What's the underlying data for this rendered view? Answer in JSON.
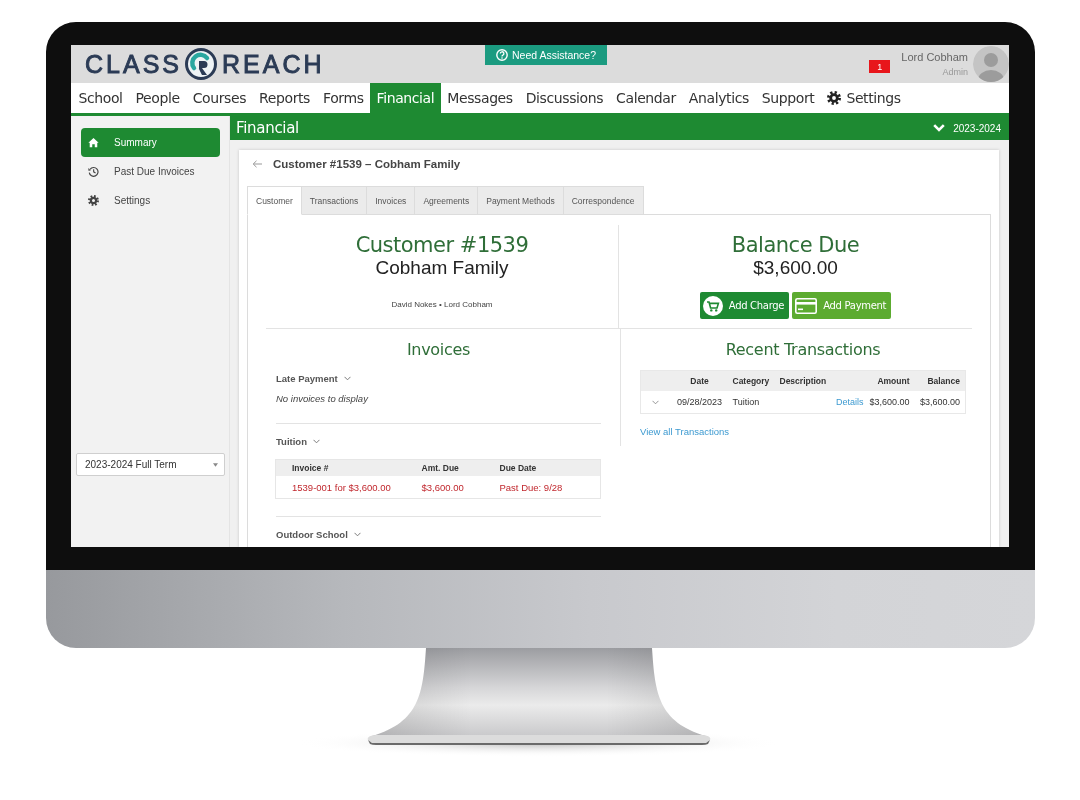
{
  "logo": {
    "left_text": "CLASS",
    "right_text": "REACH"
  },
  "help_button": {
    "label": "Need Assistance?"
  },
  "user": {
    "alert_count": "1",
    "name": "Lord Cobham",
    "role": "Admin"
  },
  "nav": [
    {
      "label": "School",
      "selected": false,
      "kind": "plain"
    },
    {
      "label": "People",
      "selected": false,
      "kind": "plain"
    },
    {
      "label": "Courses",
      "selected": false,
      "kind": "plain"
    },
    {
      "label": "Reports",
      "selected": false,
      "kind": "plain"
    },
    {
      "label": "Forms",
      "selected": false,
      "kind": "plain"
    },
    {
      "label": "Financial",
      "selected": true,
      "kind": "plain"
    },
    {
      "label": "Messages",
      "selected": false,
      "kind": "plain"
    },
    {
      "label": "Discussions",
      "selected": false,
      "kind": "plain"
    },
    {
      "label": "Calendar",
      "selected": false,
      "kind": "plain"
    },
    {
      "label": "Analytics",
      "selected": false,
      "kind": "plain"
    },
    {
      "label": "Support",
      "selected": false,
      "kind": "plain"
    },
    {
      "label": "Settings",
      "selected": false,
      "kind": "settings"
    }
  ],
  "sidebar": {
    "items": [
      {
        "label": "Summary",
        "selected": true,
        "kind": "home"
      },
      {
        "label": "Past Due Invoices",
        "selected": false,
        "kind": "history"
      },
      {
        "label": "Settings",
        "selected": false,
        "kind": "settings"
      }
    ],
    "term_select": {
      "value": "2023-2024 Full Term"
    }
  },
  "section_bar": {
    "title": "Financial",
    "year": "2023-2024"
  },
  "customer_page": {
    "title": "Customer #1539 – Cobham Family",
    "tabs": [
      {
        "label": "Customer",
        "selected": true
      },
      {
        "label": "Transactions",
        "selected": false
      },
      {
        "label": "Invoices",
        "selected": false
      },
      {
        "label": "Agreements",
        "selected": false
      },
      {
        "label": "Payment Methods",
        "selected": false
      },
      {
        "label": "Correspondence",
        "selected": false
      }
    ],
    "customer": {
      "heading": "Customer #1539",
      "name": "Cobham Family",
      "contacts": "David Nokes • Lord Cobham"
    },
    "balance": {
      "heading": "Balance Due",
      "amount": "$3,600.00",
      "buttons": [
        {
          "label": "Add Charge",
          "kind": "charge"
        },
        {
          "label": "Add Payment",
          "kind": "payment"
        }
      ]
    },
    "invoices": {
      "heading": "Invoices",
      "groups": [
        {
          "name": "Late Payment",
          "empty_text": "No invoices to display"
        },
        {
          "name": "Tuition",
          "columns": [
            "Invoice #",
            "Amt. Due",
            "Due Date"
          ],
          "rows": [
            {
              "cells": [
                "1539-001 for $3,600.00",
                "$3,600.00",
                "Past Due: 9/28"
              ],
              "past_due": true
            }
          ]
        },
        {
          "name": "Outdoor School"
        }
      ]
    },
    "recent_transactions": {
      "heading": "Recent Transactions",
      "columns": [
        "Date",
        "Category",
        "Description",
        "Amount",
        "Balance"
      ],
      "rows": [
        {
          "date": "09/28/2023",
          "category": "Tuition",
          "link": "Details",
          "amount": "$3,600.00",
          "balance": "$3,600.00"
        }
      ],
      "view_all": "View all Transactions"
    }
  }
}
